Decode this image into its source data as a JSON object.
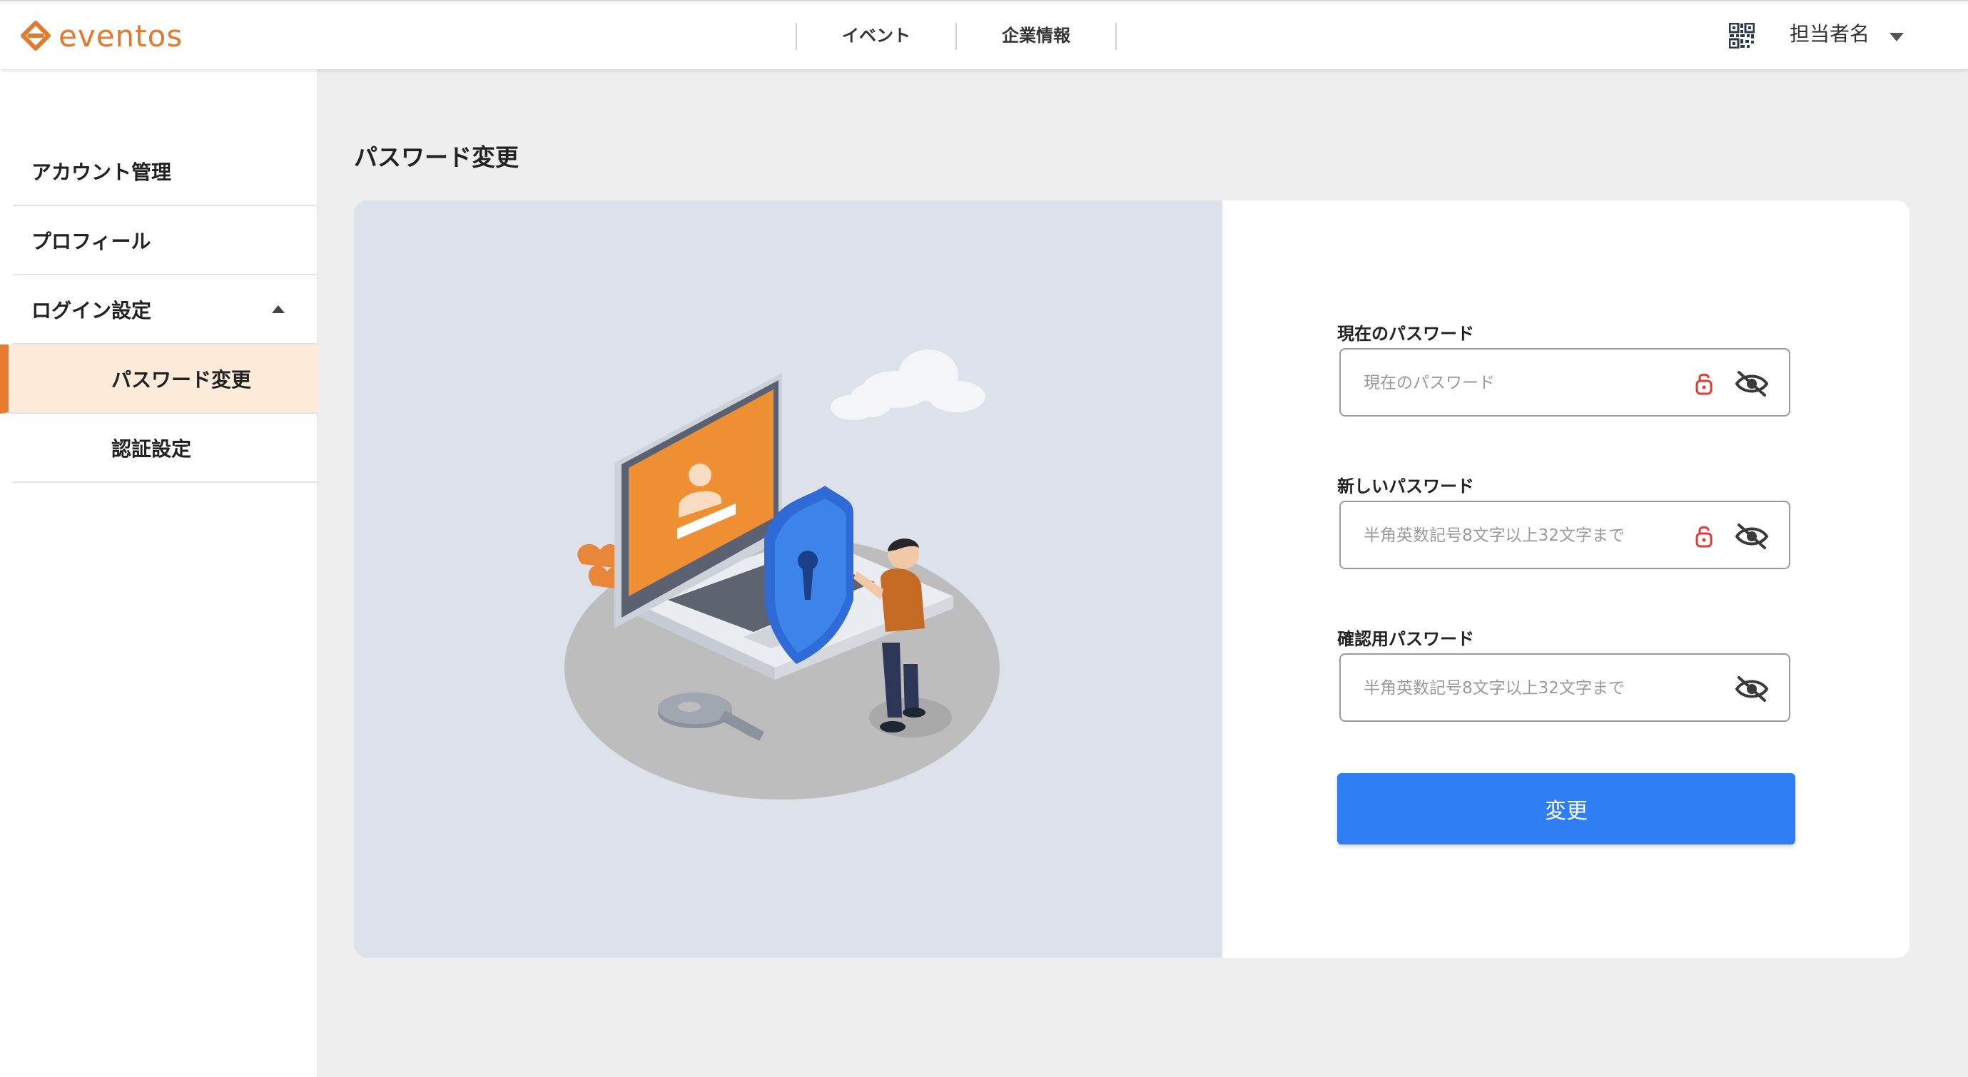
{
  "brand": {
    "name": "eventos",
    "color": "#e07a2e"
  },
  "header": {
    "nav": [
      {
        "label": "イベント"
      },
      {
        "label": "企業情報"
      }
    ],
    "qr_icon": "qr-code-icon",
    "user_name": "担当者名"
  },
  "sidebar": {
    "items": [
      {
        "label": "アカウント管理"
      },
      {
        "label": "プロフィール"
      },
      {
        "label": "ログイン設定",
        "expanded": true
      },
      {
        "label": "パスワード変更",
        "active": true
      },
      {
        "label": "認証設定"
      }
    ]
  },
  "page": {
    "title": "パスワード変更"
  },
  "form": {
    "fields": [
      {
        "label": "現在のパスワード",
        "placeholder": "現在のパスワード",
        "value": "",
        "lock": true
      },
      {
        "label": "新しいパスワード",
        "placeholder": "半角英数記号8文字以上32文字まで",
        "value": "",
        "lock": true
      },
      {
        "label": "確認用パスワード",
        "placeholder": "半角英数記号8文字以上32文字まで",
        "value": "",
        "lock": false
      }
    ],
    "submit_label": "変更"
  },
  "colors": {
    "accent": "#e87b30",
    "active_bg": "#fdebda",
    "primary_button": "#2f7ef3",
    "lock_icon": "#e53935",
    "illustration_bg": "#dde2ea"
  }
}
